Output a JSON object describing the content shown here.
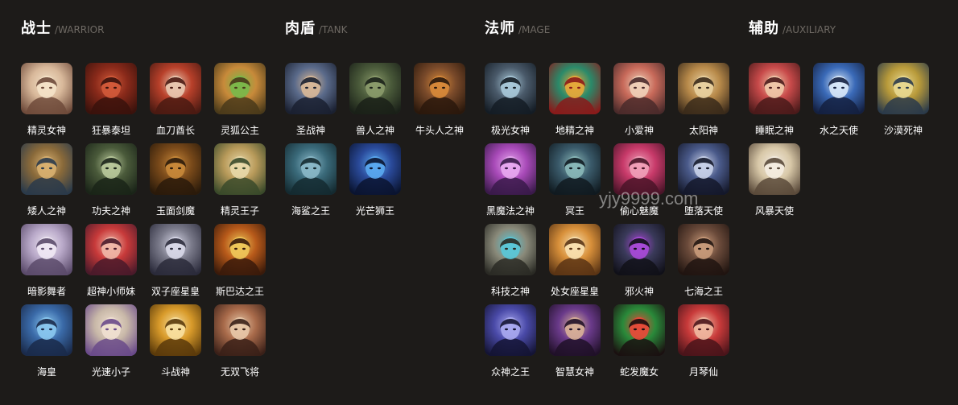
{
  "groups": [
    {
      "title": "战士",
      "subtitle": "/WARRIOR",
      "heroes": [
        {
          "name": "精灵女神",
          "colors": [
            "#d8b89a",
            "#6e4a3a",
            "#f4e2c8"
          ]
        },
        {
          "name": "狂暴泰坦",
          "colors": [
            "#8a2a1a",
            "#3a120c",
            "#d25a3a"
          ]
        },
        {
          "name": "血刀酋长",
          "colors": [
            "#b8402a",
            "#4a1a12",
            "#e8c8b0"
          ]
        },
        {
          "name": "灵狐公主",
          "colors": [
            "#c88a3a",
            "#4a3a1a",
            "#7ab84a"
          ]
        },
        {
          "name": "矮人之神",
          "colors": [
            "#8a6a3a",
            "#2a3a4a",
            "#d8b070"
          ]
        },
        {
          "name": "功夫之神",
          "colors": [
            "#4a5a3a",
            "#1a2418",
            "#b8c89a"
          ]
        },
        {
          "name": "玉面剑魔",
          "colors": [
            "#7a4a1a",
            "#2a1a0a",
            "#c8883a"
          ]
        },
        {
          "name": "精灵王子",
          "colors": [
            "#b89a5a",
            "#3a4a2a",
            "#e8d8a8"
          ]
        },
        {
          "name": "暗影舞者",
          "colors": [
            "#b8a8c8",
            "#5a4a6a",
            "#f0e8f4"
          ]
        },
        {
          "name": "超神小师妹",
          "colors": [
            "#c83a3a",
            "#4a1a2a",
            "#f0b8a8"
          ]
        },
        {
          "name": "双子座星皇",
          "colors": [
            "#7a7a8a",
            "#2a2a3a",
            "#d8d8e8"
          ]
        },
        {
          "name": "斯巴达之王",
          "colors": [
            "#b85a1a",
            "#3a1a0a",
            "#f0c85a"
          ]
        },
        {
          "name": "海皇",
          "colors": [
            "#3a6aa8",
            "#1a2a4a",
            "#8ac8f0"
          ]
        },
        {
          "name": "光速小子",
          "colors": [
            "#c8b8a8",
            "#6a4a8a",
            "#f0e0d0"
          ]
        },
        {
          "name": "斗战神",
          "colors": [
            "#d89a2a",
            "#5a3a0a",
            "#f8e0a0"
          ]
        },
        {
          "name": "无双飞将",
          "colors": [
            "#a86a4a",
            "#3a2018",
            "#e8c8a8"
          ]
        }
      ]
    },
    {
      "title": "肉盾",
      "subtitle": "/TANK",
      "heroes": [
        {
          "name": "圣战神",
          "colors": [
            "#5a6a8a",
            "#1a2030",
            "#d8b898"
          ]
        },
        {
          "name": "兽人之神",
          "colors": [
            "#4a5a3a",
            "#1a2018",
            "#8a9a6a"
          ]
        },
        {
          "name": "牛头人之神",
          "colors": [
            "#7a4a2a",
            "#2a180c",
            "#d88a3a"
          ]
        },
        {
          "name": "海鲨之王",
          "colors": [
            "#3a6a7a",
            "#142a30",
            "#8ab8c8"
          ]
        },
        {
          "name": "光芒狮王",
          "colors": [
            "#2a4a9a",
            "#0a1430",
            "#5aa8f0"
          ]
        }
      ]
    },
    {
      "title": "法师",
      "subtitle": "/MAGE",
      "heroes": [
        {
          "name": "极光女神",
          "colors": [
            "#4a5a6a",
            "#141c24",
            "#a8c8d8"
          ]
        },
        {
          "name": "地精之神",
          "colors": [
            "#2a8a6a",
            "#8a1a1a",
            "#e8a83a"
          ]
        },
        {
          "name": "小爱神",
          "colors": [
            "#c86a5a",
            "#4a2a2a",
            "#f0d0b8"
          ]
        },
        {
          "name": "太阳神",
          "colors": [
            "#b88a4a",
            "#3a2a1a",
            "#e8d0a0"
          ]
        },
        {
          "name": "黑魔法之神",
          "colors": [
            "#a84ab8",
            "#3a1a4a",
            "#e8a8f0"
          ]
        },
        {
          "name": "冥王",
          "colors": [
            "#3a5a6a",
            "#101a20",
            "#8ab8b8"
          ]
        },
        {
          "name": "偷心魅魔",
          "colors": [
            "#c83a6a",
            "#4a1428",
            "#f0a0b8"
          ]
        },
        {
          "name": "堕落天使",
          "colors": [
            "#4a5a8a",
            "#14182a",
            "#c8d0e8"
          ]
        },
        {
          "name": "科技之神",
          "colors": [
            "#8a8a7a",
            "#2a2a24",
            "#5ac8d8"
          ]
        },
        {
          "name": "处女座星皇",
          "colors": [
            "#d8903a",
            "#5a3414",
            "#f8e0b0"
          ]
        },
        {
          "name": "邪火神",
          "colors": [
            "#3a3a5a",
            "#101018",
            "#a84ad8"
          ]
        },
        {
          "name": "七海之王",
          "colors": [
            "#6a4a3a",
            "#201410",
            "#c89a7a"
          ]
        },
        {
          "name": "众神之王",
          "colors": [
            "#4a4aa8",
            "#141434",
            "#a8a8f0"
          ]
        },
        {
          "name": "智慧女神",
          "colors": [
            "#6a3a8a",
            "#201028",
            "#d8b098"
          ]
        },
        {
          "name": "蛇发魔女",
          "colors": [
            "#2a8a3a",
            "#1a1010",
            "#e84a3a"
          ]
        },
        {
          "name": "月琴仙",
          "colors": [
            "#c83a3a",
            "#4a141a",
            "#f0b8a0"
          ]
        }
      ]
    },
    {
      "title": "辅助",
      "subtitle": "/AUXILIARY",
      "heroes": [
        {
          "name": "睡眠之神",
          "colors": [
            "#c84a4a",
            "#4a1a1a",
            "#f0c8a8"
          ]
        },
        {
          "name": "水之天使",
          "colors": [
            "#3a6ab8",
            "#142040",
            "#d8e8f8"
          ]
        },
        {
          "name": "沙漠死神",
          "colors": [
            "#b89a3a",
            "#2a3a4a",
            "#e8d890"
          ]
        },
        {
          "name": "风暴天使",
          "colors": [
            "#d8c8a8",
            "#5a4a3a",
            "#f4ece0"
          ]
        }
      ]
    }
  ],
  "watermark": "yjy9999.com"
}
